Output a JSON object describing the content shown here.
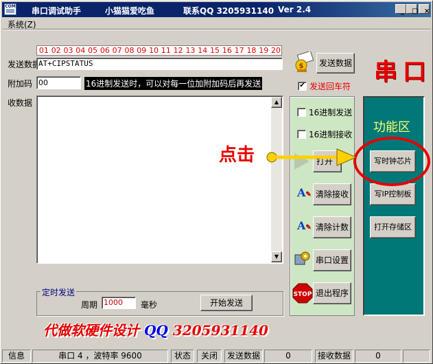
{
  "title": {
    "app": "串口调试助手",
    "author": "小猫猫爱吃鱼",
    "contact": "联系QQ 3205931140",
    "version": "Ver 2.4",
    "logo": "COM"
  },
  "menu": {
    "system": "系统(Z)"
  },
  "send": {
    "label": "发送数据",
    "numbers": [
      "01",
      "02",
      "03",
      "04",
      "05",
      "06",
      "07",
      "08",
      "09",
      "10",
      "11",
      "12",
      "13",
      "14",
      "15",
      "16",
      "17",
      "18",
      "19",
      "20"
    ],
    "value": "AT+CIPSTATUS",
    "button": "发送数据",
    "cr_checkbox": "发送回车符"
  },
  "append": {
    "label": "附加码",
    "value": "00",
    "hint": "16进制发送时，可以对每一位加附加码后再发送"
  },
  "recv": {
    "label": "收数据"
  },
  "controls": {
    "hex_send": "16进制发送",
    "hex_recv": "16进制接收",
    "open": "打开",
    "clear_recv": "清除接收",
    "clear_count": "清除计数",
    "port_settings": "串口设置",
    "exit": "退出程序",
    "stop_sign": "STOP"
  },
  "timer": {
    "title": "定时发送",
    "period_label": "周期",
    "period_value": "1000",
    "unit": "毫秒",
    "start": "开始发送"
  },
  "func": {
    "title": "功能区",
    "write_clock": "写时钟芯片",
    "write_ip": "写IP控制板",
    "open_storage": "打开存储区"
  },
  "annotations": {
    "serial": "串口",
    "click": "点击",
    "ad": "代做软硬件设计",
    "qq_label": "QQ",
    "qq_number": "3205931140"
  },
  "status": {
    "info": "信息",
    "port": "串口 4 ，波特率 9600",
    "state": "状态",
    "state_value": "关闭",
    "send_label": "发送数据",
    "send_count": "0",
    "recv_label": "接收数据",
    "recv_count": "0"
  },
  "colors": {
    "titlebar": "#0a246a",
    "teal_panel": "#007878",
    "func_title": "#ffff66",
    "green_panel": "#cde6c3",
    "annotation_red": "#e60000",
    "annotation_blue": "#0000e6",
    "numbers_red": "#e60000"
  }
}
